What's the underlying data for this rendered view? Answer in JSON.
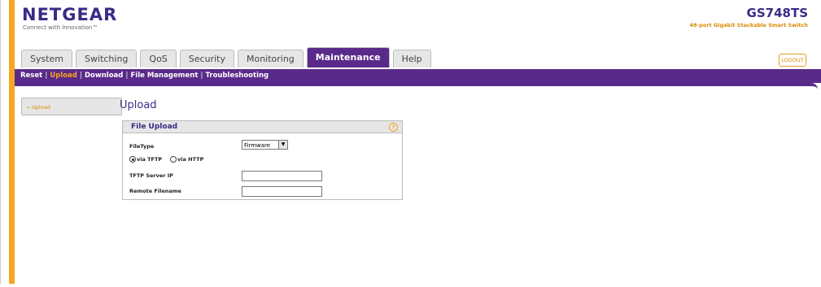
{
  "header": {
    "logo": "NETGEAR",
    "tagline": "Connect with Innovation™",
    "model": "GS748TS",
    "model_desc": "48-port Gigabit Stackable Smart Switch",
    "logout": "LOGOUT"
  },
  "tabs": [
    {
      "label": "System"
    },
    {
      "label": "Switching"
    },
    {
      "label": "QoS"
    },
    {
      "label": "Security"
    },
    {
      "label": "Monitoring"
    },
    {
      "label": "Maintenance"
    },
    {
      "label": "Help"
    }
  ],
  "subnav": [
    {
      "label": "Reset"
    },
    {
      "label": "Upload"
    },
    {
      "label": "Download"
    },
    {
      "label": "File Management"
    },
    {
      "label": "Troubleshooting"
    }
  ],
  "sidebar": {
    "item": "» Upload"
  },
  "page": {
    "title": "Upload"
  },
  "panel": {
    "title": "File Upload",
    "help": "?",
    "filetype_label": "FileType",
    "filetype_value": "Firmware",
    "radio_tftp": "via TFTP",
    "radio_http": "via HTTP",
    "tftp_label": "TFTP Server IP",
    "remote_label": "Remote Filename"
  },
  "colors": {
    "purple": "#5a2a8a",
    "orange": "#f5a623",
    "brand": "#3b2a86"
  }
}
